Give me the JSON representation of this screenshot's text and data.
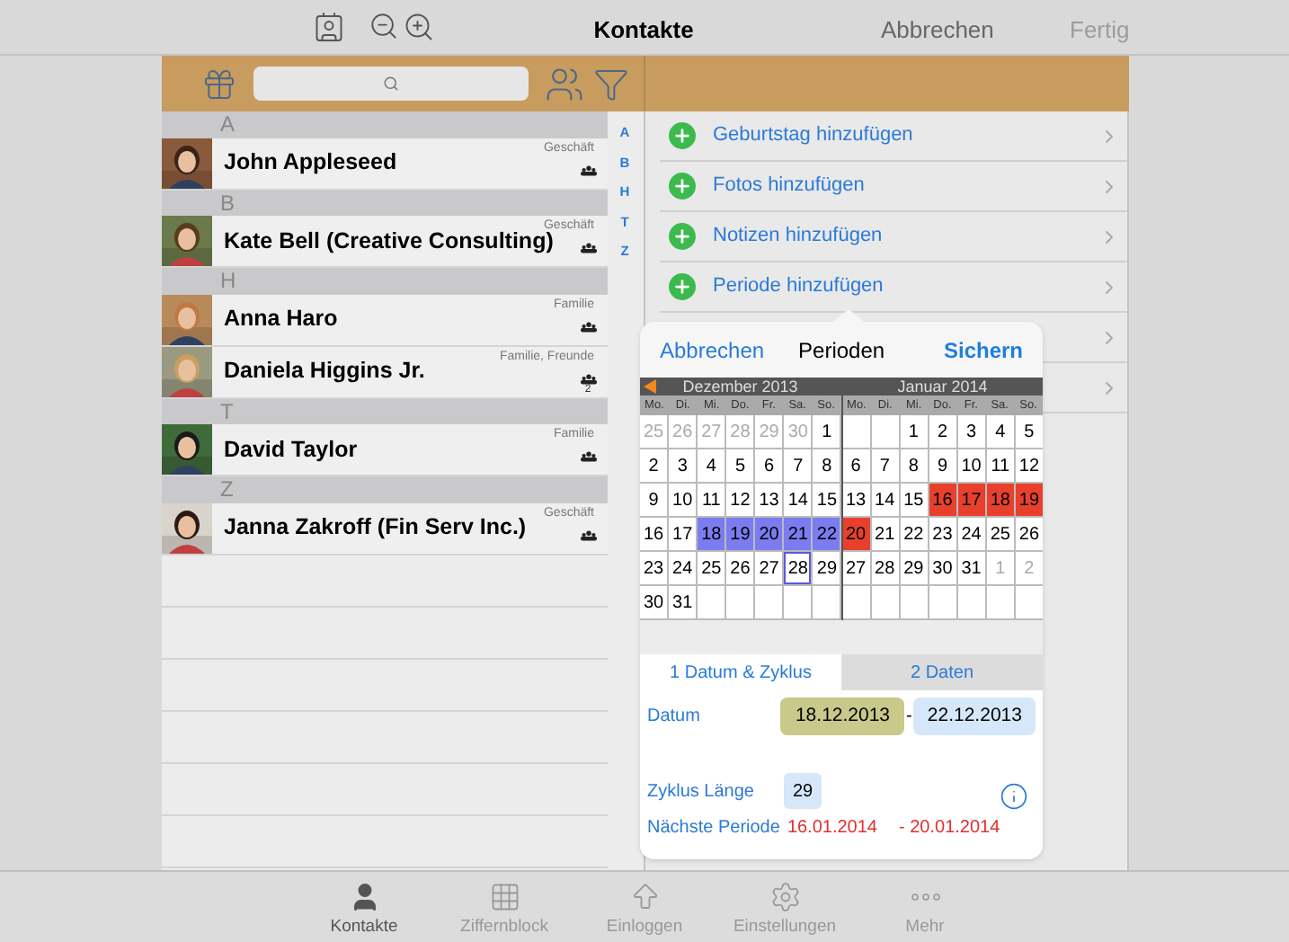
{
  "top_bar": {
    "title": "Kontakte",
    "cancel": "Abbrechen",
    "done": {
      "label": "Fertig",
      "disabled": true
    }
  },
  "contacts": [
    {
      "letter": "A",
      "people": [
        {
          "name": "John Appleseed",
          "group": "Geschäft"
        }
      ]
    },
    {
      "letter": "B",
      "people": [
        {
          "name": "Kate Bell (Creative Consulting)",
          "group": "Geschäft"
        }
      ]
    },
    {
      "letter": "H",
      "people": [
        {
          "name": "Anna Haro",
          "group": "Familie"
        },
        {
          "name": "Daniela Higgins Jr.",
          "group": "Familie, Freunde",
          "count": "2"
        }
      ]
    },
    {
      "letter": "T",
      "people": [
        {
          "name": "David Taylor",
          "group": "Familie"
        }
      ]
    },
    {
      "letter": "Z",
      "people": [
        {
          "name": "Janna Zakroff (Fin Serv Inc.)",
          "group": "Geschäft"
        }
      ]
    }
  ],
  "index": [
    "A",
    "B",
    "H",
    "T",
    "Z"
  ],
  "actions": [
    {
      "label": "Geburtstag hinzufügen"
    },
    {
      "label": "Fotos hinzufügen"
    },
    {
      "label": "Notizen hinzufügen"
    },
    {
      "label": "Periode hinzufügen"
    }
  ],
  "popover": {
    "cancel": "Abbrechen",
    "title": "Perioden",
    "save": "Sichern",
    "months": [
      {
        "title": "Dezember 2013",
        "weekdays": [
          "Mo.",
          "Di.",
          "Mi.",
          "Do.",
          "Fr.",
          "Sa.",
          "So."
        ],
        "weeks": [
          [
            {
              "day": "25",
              "kind": "outside"
            },
            {
              "day": "26",
              "kind": "outside"
            },
            {
              "day": "27",
              "kind": "outside"
            },
            {
              "day": "28",
              "kind": "outside"
            },
            {
              "day": "29",
              "kind": "outside"
            },
            {
              "day": "30",
              "kind": "outside"
            },
            {
              "day": "1",
              "kind": "normal"
            }
          ],
          [
            {
              "day": "2",
              "kind": "normal"
            },
            {
              "day": "3",
              "kind": "normal"
            },
            {
              "day": "4",
              "kind": "normal"
            },
            {
              "day": "5",
              "kind": "normal"
            },
            {
              "day": "6",
              "kind": "normal"
            },
            {
              "day": "7",
              "kind": "normal"
            },
            {
              "day": "8",
              "kind": "normal"
            }
          ],
          [
            {
              "day": "9",
              "kind": "normal"
            },
            {
              "day": "10",
              "kind": "normal"
            },
            {
              "day": "11",
              "kind": "normal"
            },
            {
              "day": "12",
              "kind": "normal"
            },
            {
              "day": "13",
              "kind": "normal"
            },
            {
              "day": "14",
              "kind": "normal"
            },
            {
              "day": "15",
              "kind": "normal"
            }
          ],
          [
            {
              "day": "16",
              "kind": "normal"
            },
            {
              "day": "17",
              "kind": "normal"
            },
            {
              "day": "18",
              "kind": "period"
            },
            {
              "day": "19",
              "kind": "period"
            },
            {
              "day": "20",
              "kind": "period"
            },
            {
              "day": "21",
              "kind": "period"
            },
            {
              "day": "22",
              "kind": "period"
            }
          ],
          [
            {
              "day": "23",
              "kind": "normal"
            },
            {
              "day": "24",
              "kind": "normal"
            },
            {
              "day": "25",
              "kind": "normal"
            },
            {
              "day": "26",
              "kind": "normal"
            },
            {
              "day": "27",
              "kind": "normal"
            },
            {
              "day": "28",
              "kind": "today"
            },
            {
              "day": "29",
              "kind": "normal"
            }
          ],
          [
            {
              "day": "30",
              "kind": "normal"
            },
            {
              "day": "31",
              "kind": "normal"
            },
            {
              "kind": "blank"
            },
            {
              "kind": "blank"
            },
            {
              "kind": "blank"
            },
            {
              "kind": "blank"
            },
            {
              "kind": "blank"
            }
          ]
        ]
      },
      {
        "title": "Januar 2014",
        "weekdays": [
          "Mo.",
          "Di.",
          "Mi.",
          "Do.",
          "Fr.",
          "Sa.",
          "So."
        ],
        "weeks": [
          [
            {
              "kind": "blank"
            },
            {
              "kind": "blank"
            },
            {
              "day": "1",
              "kind": "normal"
            },
            {
              "day": "2",
              "kind": "normal"
            },
            {
              "day": "3",
              "kind": "normal"
            },
            {
              "day": "4",
              "kind": "normal"
            },
            {
              "day": "5",
              "kind": "normal"
            }
          ],
          [
            {
              "day": "6",
              "kind": "normal"
            },
            {
              "day": "7",
              "kind": "normal"
            },
            {
              "day": "8",
              "kind": "normal"
            },
            {
              "day": "9",
              "kind": "normal"
            },
            {
              "day": "10",
              "kind": "normal"
            },
            {
              "day": "11",
              "kind": "normal"
            },
            {
              "day": "12",
              "kind": "normal"
            }
          ],
          [
            {
              "day": "13",
              "kind": "normal"
            },
            {
              "day": "14",
              "kind": "normal"
            },
            {
              "day": "15",
              "kind": "normal"
            },
            {
              "day": "16",
              "kind": "predicted"
            },
            {
              "day": "17",
              "kind": "predicted"
            },
            {
              "day": "18",
              "kind": "predicted"
            },
            {
              "day": "19",
              "kind": "predicted"
            }
          ],
          [
            {
              "day": "20",
              "kind": "predicted"
            },
            {
              "day": "21",
              "kind": "normal"
            },
            {
              "day": "22",
              "kind": "normal"
            },
            {
              "day": "23",
              "kind": "normal"
            },
            {
              "day": "24",
              "kind": "normal"
            },
            {
              "day": "25",
              "kind": "normal"
            },
            {
              "day": "26",
              "kind": "normal"
            }
          ],
          [
            {
              "day": "27",
              "kind": "normal"
            },
            {
              "day": "28",
              "kind": "normal"
            },
            {
              "day": "29",
              "kind": "normal"
            },
            {
              "day": "30",
              "kind": "normal"
            },
            {
              "day": "31",
              "kind": "normal"
            },
            {
              "day": "1",
              "kind": "outside"
            },
            {
              "day": "2",
              "kind": "outside"
            }
          ],
          [
            {
              "kind": "blank"
            },
            {
              "kind": "blank"
            },
            {
              "kind": "blank"
            },
            {
              "kind": "blank"
            },
            {
              "kind": "blank"
            },
            {
              "kind": "blank"
            },
            {
              "kind": "blank"
            }
          ]
        ]
      }
    ],
    "tabs": [
      {
        "label": "1 Datum & Zyklus",
        "selected": true
      },
      {
        "label": "2 Daten",
        "selected": false
      }
    ],
    "date_label": "Datum",
    "dates": [
      {
        "value": "18.12.2013",
        "color": "#c8c98a"
      },
      {
        "value": "22.12.2013",
        "color": "#d5e7f8"
      }
    ],
    "date_separator": "-",
    "cycle_label": "Zyklus Länge",
    "cycle_value": "29",
    "next_label": "Nächste Periode",
    "next_start": "16.01.2014",
    "next_end": "- 20.01.2014"
  },
  "tab_bar": [
    {
      "label": "Kontakte",
      "selected": true
    },
    {
      "label": "Ziffernblock",
      "selected": false
    },
    {
      "label": "Einloggen",
      "selected": false
    },
    {
      "label": "Einstellungen",
      "selected": false
    },
    {
      "label": "Mehr",
      "selected": false
    }
  ]
}
